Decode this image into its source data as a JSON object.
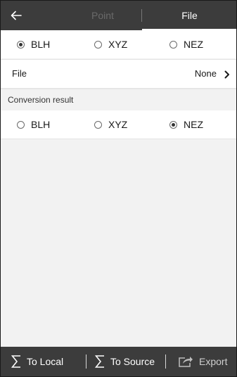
{
  "header": {
    "back_icon": "arrow-left-icon",
    "tabs": [
      {
        "label": "Point",
        "active": false
      },
      {
        "label": "File",
        "active": true
      }
    ]
  },
  "source_format": {
    "options": [
      {
        "label": "BLH",
        "selected": true
      },
      {
        "label": "XYZ",
        "selected": false
      },
      {
        "label": "NEZ",
        "selected": false
      }
    ]
  },
  "file": {
    "label": "File",
    "value": "None",
    "chevron_icon": "chevron-right-icon"
  },
  "result": {
    "section_title": "Conversion result",
    "options": [
      {
        "label": "BLH",
        "selected": false
      },
      {
        "label": "XYZ",
        "selected": false
      },
      {
        "label": "NEZ",
        "selected": true
      }
    ]
  },
  "toolbar": {
    "to_local_label": "To Local",
    "to_local_icon": "sigma-icon",
    "to_source_label": "To Source",
    "to_source_icon": "sigma-icon",
    "export_label": "Export",
    "export_icon": "share-export-icon"
  },
  "colors": {
    "header_bg": "#3c3c3c",
    "body_bg": "#f2f2f2",
    "row_bg": "#ffffff",
    "inactive_tab": "#6a6a6a"
  }
}
